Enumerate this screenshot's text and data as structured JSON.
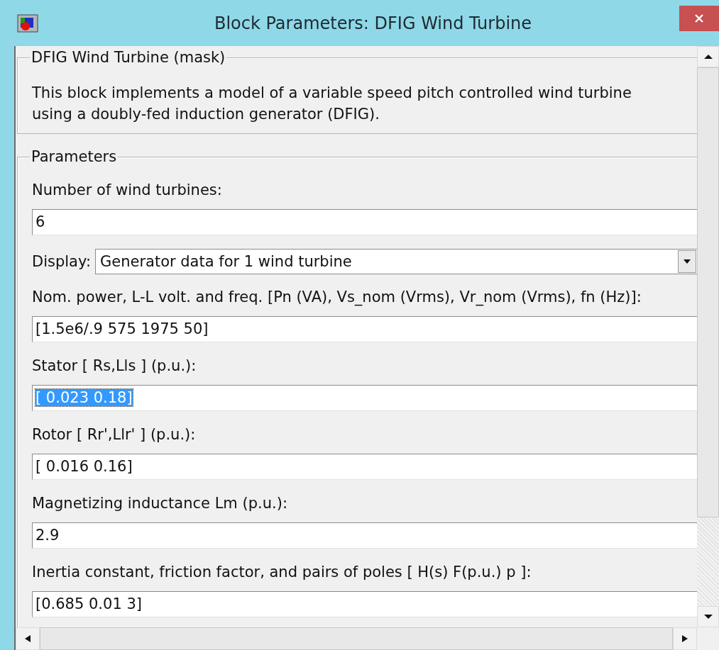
{
  "window": {
    "title": "Block Parameters: DFIG Wind Turbine"
  },
  "description": {
    "legend": "DFIG Wind Turbine (mask)",
    "text": "This block implements a  model of a variable speed pitch controlled wind turbine using a doubly-fed induction generator (DFIG)."
  },
  "parameters": {
    "legend": "Parameters",
    "items": [
      {
        "kind": "edit",
        "label": "Number of wind turbines:",
        "value": "6",
        "text_selected": false
      },
      {
        "kind": "popup",
        "label": "Display:",
        "value": "Generator data for 1 wind turbine"
      },
      {
        "kind": "edit",
        "label": "Nom. power, L-L volt. and freq. [Pn (VA), Vs_nom (Vrms), Vr_nom (Vrms), fn (Hz)]:",
        "value": "[1.5e6/.9 575 1975 50]",
        "text_selected": false
      },
      {
        "kind": "edit",
        "label": "Stator [ Rs,Lls ] (p.u.):",
        "value": "[ 0.023 0.18]",
        "text_selected": true
      },
      {
        "kind": "edit",
        "label": "Rotor [ Rr',Llr' ] (p.u.):",
        "value": "[ 0.016 0.16]",
        "text_selected": false
      },
      {
        "kind": "edit",
        "label": "Magnetizing inductance Lm (p.u.):",
        "value": "2.9",
        "text_selected": false
      },
      {
        "kind": "edit",
        "label": "Inertia constant, friction factor, and pairs of poles [ H(s)  F(p.u.)  p ]:",
        "value": "[0.685 0.01 3]",
        "text_selected": false
      }
    ]
  }
}
